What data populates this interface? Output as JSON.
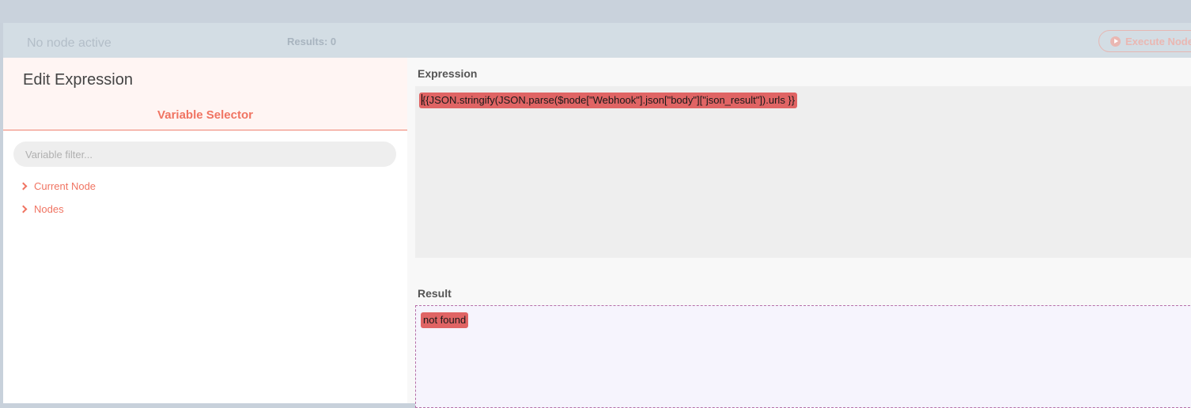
{
  "background": {
    "no_node_text": "No node active",
    "results_label": "Results: 0",
    "execute_button": "Execute Node"
  },
  "dialog": {
    "title": "Edit Expression",
    "variable_selector": {
      "heading": "Variable Selector",
      "filter_placeholder": "Variable filter...",
      "items": [
        {
          "label": "Current Node"
        },
        {
          "label": "Nodes"
        }
      ]
    },
    "expression": {
      "label": "Expression",
      "value": "{{JSON.stringify(JSON.parse($node[\"Webhook\"].json[\"body\"][\"json_result\"]).urls }}"
    },
    "result": {
      "label": "Result",
      "value": "not found"
    }
  },
  "colors": {
    "accent": "#f07462",
    "error_highlight": "#e06464"
  }
}
